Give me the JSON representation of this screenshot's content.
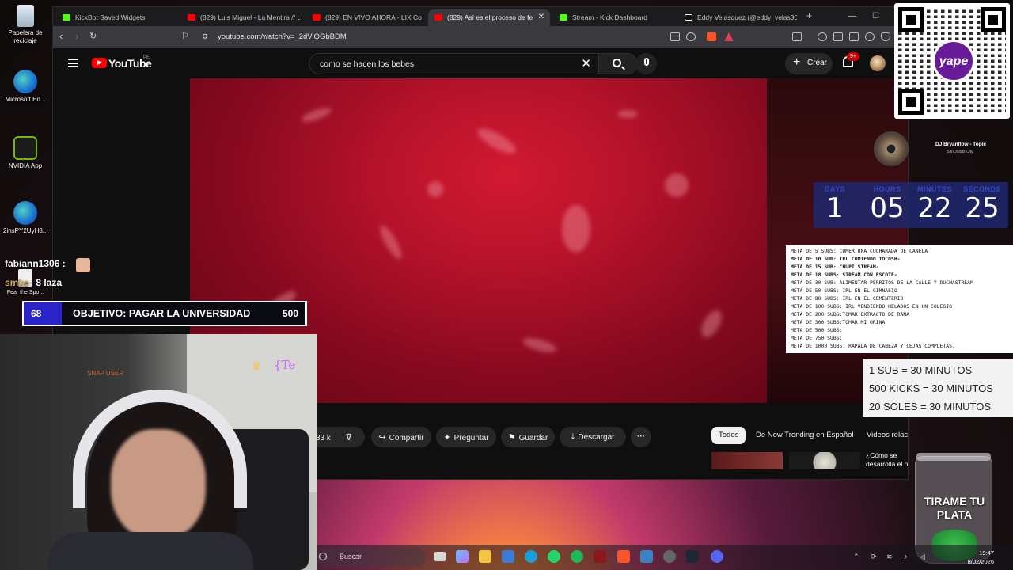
{
  "desktop": {
    "icons": [
      {
        "label": "Papelera de reciclaje"
      },
      {
        "label": "Microsoft Ed..."
      },
      {
        "label": "NVIDIA App"
      },
      {
        "label": "2insPY2UyH8..."
      },
      {
        "label": "Fear the Spo..."
      }
    ]
  },
  "browser": {
    "tabs": [
      {
        "label": "KickBot Saved Widgets",
        "color": "#53fc18"
      },
      {
        "label": "(829) Luis Miguel - La Mentira // Le",
        "color": "#ff0000"
      },
      {
        "label": "(829) EN VIVO AHORA - LIX Co",
        "color": "#ff0000"
      },
      {
        "label": "(829) Así es el proceso de fe",
        "color": "#ff0000",
        "active": true
      },
      {
        "label": "Stream - Kick Dashboard",
        "color": "#53fc18"
      },
      {
        "label": "Eddy Velasquez (@eddy_velas30) e",
        "color": "#111111"
      }
    ],
    "url": "youtube.com/watch?v=_2dViQGbBDM"
  },
  "youtube": {
    "logo_text": "YouTube",
    "region": "PE",
    "search_query": "como se hacen los bebes",
    "create_label": "Crear",
    "notifications_badge": "9+"
  },
  "video_actions": {
    "likes": "33 k",
    "share": "Compartir",
    "ask": "Preguntar",
    "save": "Guardar",
    "download": "Descargar",
    "more": "···"
  },
  "chips": [
    "Todos",
    "De Now Trending en Español",
    "Videos relacio"
  ],
  "related": {
    "first_title": "¿Cómo se desarrolla el part"
  },
  "overlay": {
    "qr_brand": "yape",
    "music": {
      "title": "DJ Bryanflow - Topic",
      "subtitle": "San Judas City"
    },
    "countdown": [
      {
        "label": "DAYS",
        "value": "1"
      },
      {
        "label": "HOURS",
        "value": "05"
      },
      {
        "label": "MINUTES",
        "value": "22"
      },
      {
        "label": "SECONDS",
        "value": "25"
      }
    ],
    "goals": [
      {
        "text": "META DE 5 SUBS: COMER UNA CUCHARADA DE CANELA",
        "bold": false
      },
      {
        "text": "META DE 10 SUB: IRL COMIENDO TOCOSH-",
        "bold": true
      },
      {
        "text": "META DE 15 SUB: CHUPI STREAM-",
        "bold": true
      },
      {
        "text": "META DE 18 SUBS: STREAM CON ESCOTE-",
        "bold": true
      },
      {
        "text": "META DE 30 SUB:  ALIMENTAR PERRITOS DE LA CALLE Y DUCHASTREAM",
        "bold": false
      },
      {
        "text": "META DE 50 SUBS: IRL EN EL GIMNASIO",
        "bold": false
      },
      {
        "text": "META DE 80 SUBS: IRL EN EL CEMENTERIO",
        "bold": false
      },
      {
        "text": "META DE 100 SUBS: IRL VENDIENDO HELADOS EN UN COLEGIO",
        "bold": false
      },
      {
        "text": "META DE 200 SUBS:TOMAR EXTRACTO DE RANA",
        "bold": false
      },
      {
        "text": "META DE 300 SUBS:TOMAR MI ORINA",
        "bold": false
      },
      {
        "text": "META DE 500 SUBS:",
        "bold": false
      },
      {
        "text": "META DE 750 SUBS:",
        "bold": false
      },
      {
        "text": "META DE 1000 SUBS: RAPADA DE CABEZA Y CEJAS COMPLETAS.",
        "bold": false
      }
    ],
    "rates": [
      "1 SUB = 30 MINUTOS",
      "500 KICKS = 30 MINUTOS",
      "20 SOLES = 30 MINUTOS"
    ],
    "jar_text": "TIRAME TU PLATA",
    "chat": [
      {
        "user": "fabiann1306 :",
        "message": ""
      },
      {
        "user": "smke",
        "message": ": 8 laza"
      }
    ],
    "objective": {
      "current": "68",
      "label": "OBJETIVO: PAGAR LA UNIVERSIDAD",
      "target": "500"
    },
    "cam_label": "SNAP USER",
    "cam_name": "{Te"
  },
  "taskbar": {
    "search": "Buscar",
    "time": "19:47",
    "date": "8/02/2026"
  }
}
